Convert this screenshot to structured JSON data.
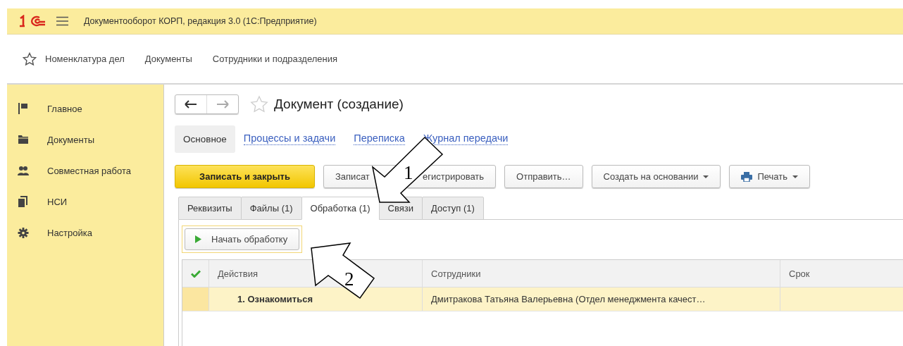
{
  "window": {
    "title": "Документооборот КОРП, редакция 3.0  (1С:Предприятие)"
  },
  "nav_bar": {
    "items": [
      "Номенклатура дел",
      "Документы",
      "Сотрудники и подразделения"
    ]
  },
  "sidebar": {
    "items": [
      {
        "label": "Главное"
      },
      {
        "label": "Документы"
      },
      {
        "label": "Совместная работа"
      },
      {
        "label": "НСИ"
      },
      {
        "label": "Настройка"
      }
    ]
  },
  "form": {
    "title": "Документ (создание)",
    "sections": [
      {
        "label": "Основное",
        "selected": true
      },
      {
        "label": "Процессы и задачи",
        "selected": false
      },
      {
        "label": "Переписка",
        "selected": false
      },
      {
        "label": "Журнал передачи",
        "selected": false
      }
    ],
    "buttons": [
      {
        "label": "Записать и закрыть",
        "kind": "primary"
      },
      {
        "label": "Записат",
        "kind": "plain"
      },
      {
        "label": "егистрировать",
        "kind": "plain"
      },
      {
        "label": "Отправить…",
        "kind": "plain"
      },
      {
        "label": "Создать на основании",
        "kind": "dropdown"
      },
      {
        "label": "Печать",
        "kind": "print"
      }
    ],
    "tabs": [
      {
        "label": "Реквизиты",
        "selected": false
      },
      {
        "label": "Файлы (1)",
        "selected": false
      },
      {
        "label": "Обработка (1)",
        "selected": true
      },
      {
        "label": "Связи",
        "selected": false
      },
      {
        "label": "Доступ (1)",
        "selected": false
      }
    ],
    "start_button": "Начать обработку",
    "table": {
      "columns": [
        "Действия",
        "Сотрудники",
        "Срок"
      ],
      "rows": [
        {
          "action": "1. Ознакомиться",
          "employees": "Дмитракова Татьяна Валерьевна (Отдел менеджмента качест…",
          "selected": true
        }
      ]
    }
  },
  "annotations": [
    {
      "label": "1"
    },
    {
      "label": "2"
    }
  ]
}
